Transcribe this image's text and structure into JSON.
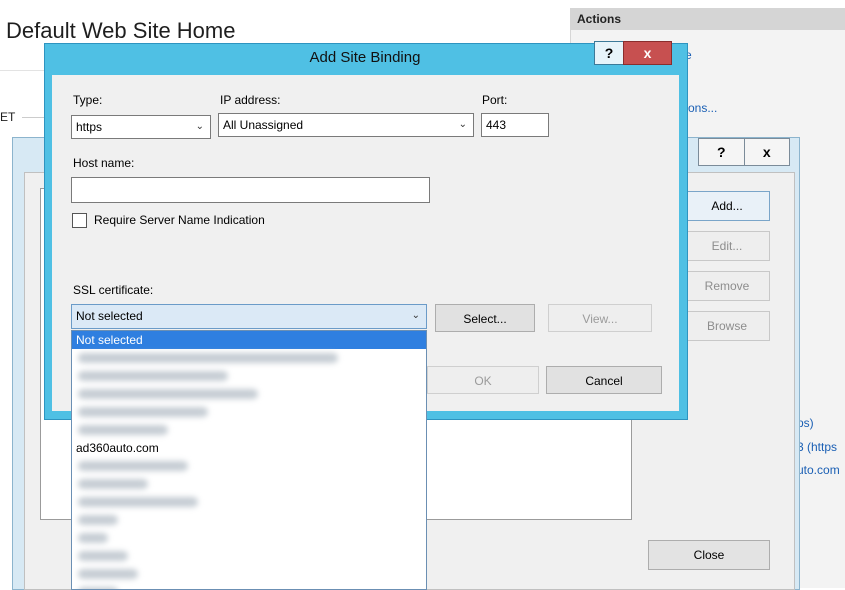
{
  "background": {
    "window_title": "Default Web Site Home",
    "left_fragment": "ET",
    "actions_title": "Actions",
    "actions_links": [
      "e",
      "ons...",
      "ps)",
      "3 (https",
      "uto.com"
    ]
  },
  "site_bindings": {
    "title_buttons": {
      "help": "?",
      "close": "x"
    },
    "buttons": {
      "add": "Add...",
      "edit": "Edit...",
      "remove": "Remove",
      "browse": "Browse",
      "close": "Close"
    }
  },
  "add_site_binding": {
    "title": "Add Site Binding",
    "title_buttons": {
      "help": "?",
      "close": "x"
    },
    "type": {
      "label": "Type:",
      "value": "https"
    },
    "ip_address": {
      "label": "IP address:",
      "value": "All Unassigned"
    },
    "port": {
      "label": "Port:",
      "value": "443"
    },
    "host_name": {
      "label": "Host name:",
      "value": ""
    },
    "require_sni": {
      "label": "Require Server Name Indication",
      "checked": false
    },
    "ssl_certificate": {
      "label": "SSL certificate:",
      "value": "Not selected",
      "options": [
        "Not selected",
        "",
        "",
        "",
        "",
        "",
        "ad360auto.com",
        "",
        "",
        "",
        "",
        "",
        "",
        "",
        ""
      ]
    },
    "buttons": {
      "select": "Select...",
      "view": "View...",
      "ok": "OK",
      "cancel": "Cancel"
    }
  },
  "colors": {
    "dialog_frame": "#4fc0e4",
    "close_button": "#c75050",
    "selection": "#2f7fe0",
    "link": "#1a5fb4"
  }
}
